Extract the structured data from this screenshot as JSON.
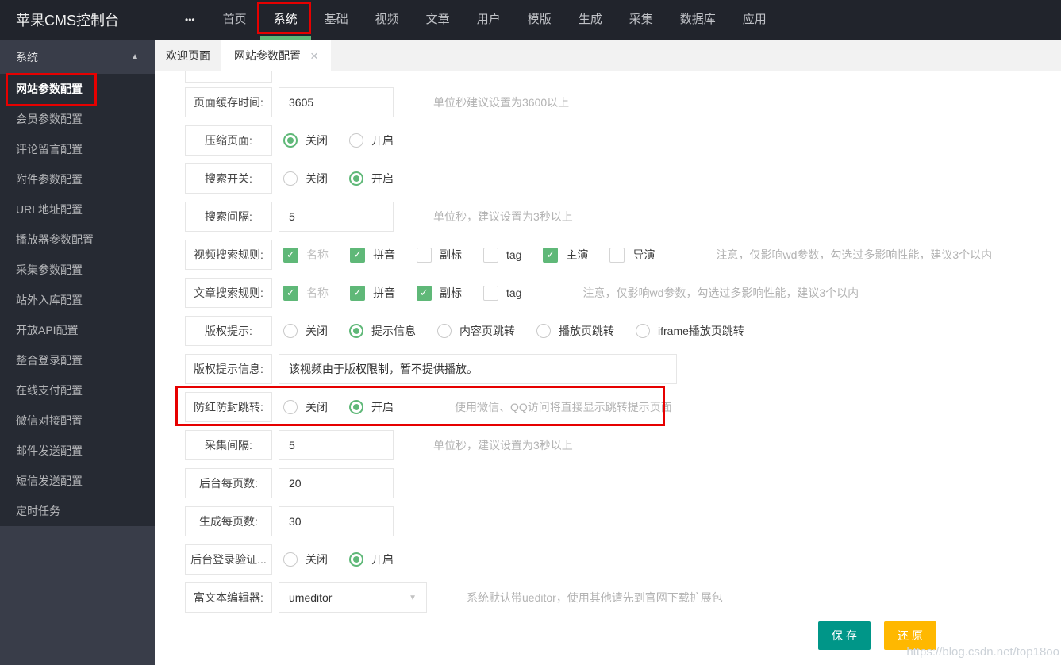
{
  "colors": {
    "accent_green": "#5FB878",
    "save_button_green": "#009688",
    "restore_button_yellow": "#FFB800",
    "annotation_red": "#E60000"
  },
  "icons": {
    "nav_more": "•••",
    "sidebar_collapse": "▲",
    "tab_close": "×",
    "checkbox_check": "✓",
    "select_dropdown": "▼"
  },
  "topnav": {
    "brand": "苹果CMS控制台",
    "items": [
      {
        "label": "首页"
      },
      {
        "label": "系统",
        "active": true,
        "annotated": true
      },
      {
        "label": "基础"
      },
      {
        "label": "视频"
      },
      {
        "label": "文章"
      },
      {
        "label": "用户"
      },
      {
        "label": "模版"
      },
      {
        "label": "生成"
      },
      {
        "label": "采集"
      },
      {
        "label": "数据库"
      },
      {
        "label": "应用"
      }
    ]
  },
  "sidebar": {
    "group_title": "系统",
    "items": [
      {
        "label": "网站参数配置",
        "active": true,
        "annotated": true
      },
      {
        "label": "会员参数配置"
      },
      {
        "label": "评论留言配置"
      },
      {
        "label": "附件参数配置"
      },
      {
        "label": "URL地址配置"
      },
      {
        "label": "播放器参数配置"
      },
      {
        "label": "采集参数配置"
      },
      {
        "label": "站外入库配置"
      },
      {
        "label": "开放API配置"
      },
      {
        "label": "整合登录配置"
      },
      {
        "label": "在线支付配置"
      },
      {
        "label": "微信对接配置"
      },
      {
        "label": "邮件发送配置"
      },
      {
        "label": "短信发送配置"
      },
      {
        "label": "定时任务"
      }
    ]
  },
  "tabs": [
    {
      "label": "欢迎页面"
    },
    {
      "label": "网站参数配置",
      "active": true,
      "closable": true
    }
  ],
  "form": {
    "rows": [
      {
        "type": "input",
        "label": "页面缓存时间:",
        "value": "3605",
        "hint": "单位秒建议设置为3600以上"
      },
      {
        "type": "radio",
        "label": "压缩页面:",
        "options": [
          {
            "label": "关闭",
            "checked": true
          },
          {
            "label": "开启"
          }
        ]
      },
      {
        "type": "radio",
        "label": "搜索开关:",
        "options": [
          {
            "label": "关闭"
          },
          {
            "label": "开启",
            "checked": true
          }
        ]
      },
      {
        "type": "input",
        "label": "搜索间隔:",
        "value": "5",
        "hint": "单位秒，建议设置为3秒以上"
      },
      {
        "type": "checkbox",
        "label": "视频搜索规则:",
        "options": [
          {
            "label": "名称",
            "checked": true,
            "muted": true
          },
          {
            "label": "拼音",
            "checked": true
          },
          {
            "label": "副标"
          },
          {
            "label": "tag"
          },
          {
            "label": "主演",
            "checked": true
          },
          {
            "label": "导演"
          }
        ],
        "hint": "注意，仅影响wd参数，勾选过多影响性能，建议3个以内"
      },
      {
        "type": "checkbox",
        "label": "文章搜索规则:",
        "options": [
          {
            "label": "名称",
            "checked": true,
            "muted": true
          },
          {
            "label": "拼音",
            "checked": true
          },
          {
            "label": "副标",
            "checked": true
          },
          {
            "label": "tag"
          }
        ],
        "hint": "注意，仅影响wd参数，勾选过多影响性能，建议3个以内"
      },
      {
        "type": "radio",
        "label": "版权提示:",
        "options": [
          {
            "label": "关闭"
          },
          {
            "label": "提示信息",
            "checked": true
          },
          {
            "label": "内容页跳转"
          },
          {
            "label": "播放页跳转"
          },
          {
            "label": "iframe播放页跳转"
          }
        ]
      },
      {
        "type": "input",
        "label": "版权提示信息:",
        "value": "该视频由于版权限制，暂不提供播放。",
        "wide": true
      },
      {
        "type": "radio",
        "label": "防红防封跳转:",
        "options": [
          {
            "label": "关闭"
          },
          {
            "label": "开启",
            "checked": true
          }
        ],
        "hint": "使用微信、QQ访问将直接显示跳转提示页面",
        "annotated": true
      },
      {
        "type": "input",
        "label": "采集间隔:",
        "value": "5",
        "hint": "单位秒，建议设置为3秒以上"
      },
      {
        "type": "input",
        "label": "后台每页数:",
        "value": "20"
      },
      {
        "type": "input",
        "label": "生成每页数:",
        "value": "30"
      },
      {
        "type": "radio",
        "label": "后台登录验证...",
        "options": [
          {
            "label": "关闭"
          },
          {
            "label": "开启",
            "checked": true
          }
        ]
      },
      {
        "type": "select",
        "label": "富文本编辑器:",
        "value": "umeditor",
        "hint": "系统默认带ueditor，使用其他请先到官网下载扩展包"
      }
    ]
  },
  "buttons": {
    "save": "保 存",
    "restore": "还 原"
  },
  "watermark": "https://blog.csdn.net/top18oo"
}
